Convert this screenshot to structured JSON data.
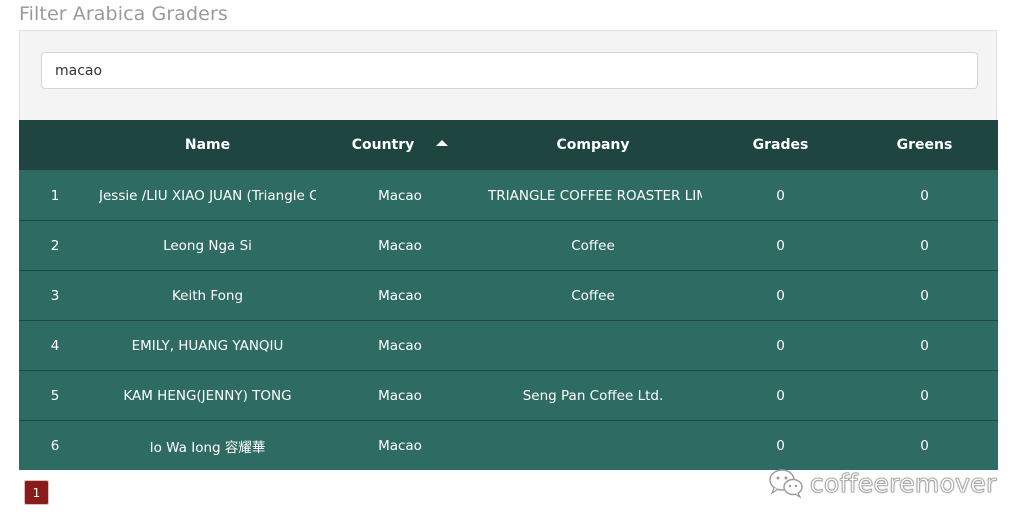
{
  "filter": {
    "title": "Filter Arabica Graders",
    "search_value": "macao"
  },
  "table": {
    "headers": {
      "num": "",
      "name": "Name",
      "country": "Country",
      "company": "Company",
      "grades": "Grades",
      "greens": "Greens"
    },
    "sort": {
      "column": "Country",
      "direction": "ascending",
      "icon": "triangle-up-icon"
    },
    "rows": [
      {
        "num": "1",
        "name": "Jessie /LIU XIAO JUAN (Triangle Coffee Roaster Limited)",
        "country": "Macao",
        "company": "TRIANGLE COFFEE ROASTER LIMITED",
        "grades": "0",
        "greens": "0"
      },
      {
        "num": "2",
        "name": "Leong Nga Si",
        "country": "Macao",
        "company": "Coffee",
        "grades": "0",
        "greens": "0"
      },
      {
        "num": "3",
        "name": "Keith Fong",
        "country": "Macao",
        "company": "Coffee",
        "grades": "0",
        "greens": "0"
      },
      {
        "num": "4",
        "name": "EMILY, HUANG YANQIU",
        "country": "Macao",
        "company": "",
        "grades": "0",
        "greens": "0"
      },
      {
        "num": "5",
        "name": "KAM HENG(JENNY) TONG",
        "country": "Macao",
        "company": "Seng Pan Coffee Ltd.",
        "grades": "0",
        "greens": "0"
      },
      {
        "num": "6",
        "name": "Io Wa Iong 容耀華",
        "country": "Macao",
        "company": "",
        "grades": "0",
        "greens": "0"
      }
    ]
  },
  "pagination": {
    "current_page": "1"
  },
  "watermark": {
    "text": "coffeeremover",
    "icon": "wechat-icon"
  },
  "colors": {
    "header_bg": "#1e4540",
    "row_bg": "#2e6b62",
    "page_button": "#8b1a1a"
  }
}
